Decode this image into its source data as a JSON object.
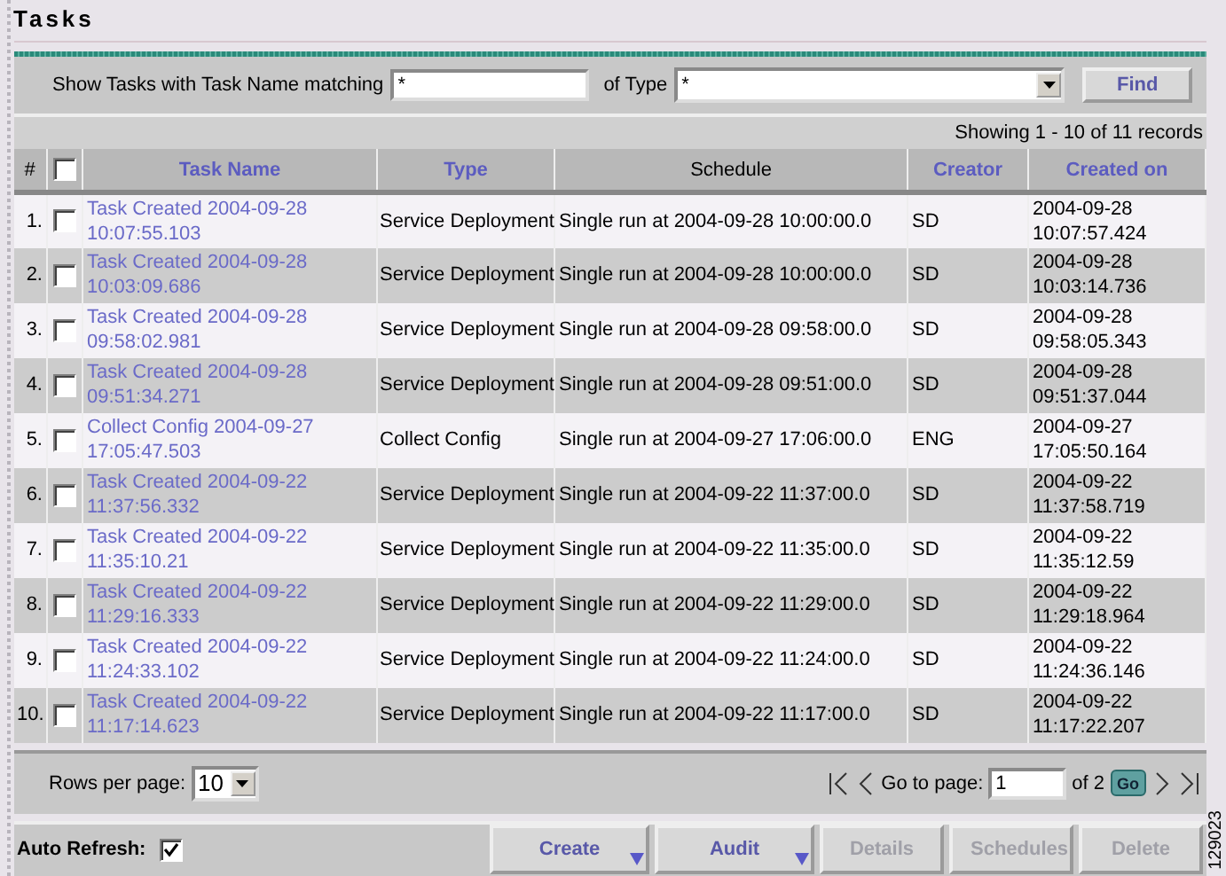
{
  "title": "Tasks",
  "filter": {
    "name_label": "Show Tasks with Task Name matching",
    "name_value": "*",
    "type_label": "of Type",
    "type_value": "*",
    "find_button": "Find"
  },
  "record_count": "Showing 1 - 10 of 11 records",
  "table": {
    "select_all_checked": false,
    "columns": [
      {
        "label": "#",
        "sortable": false
      },
      {
        "label": "Task Name",
        "sortable": true
      },
      {
        "label": "Type",
        "sortable": true
      },
      {
        "label": "Schedule",
        "sortable": false
      },
      {
        "label": "Creator",
        "sortable": true
      },
      {
        "label": "Created on",
        "sortable": true
      }
    ],
    "rows": [
      {
        "index": "1.",
        "checked": false,
        "task_name": "Task Created 2004-09-28 10:07:55.103",
        "type": "Service Deployment",
        "schedule": "Single run at 2004-09-28 10:00:00.0",
        "creator": "SD",
        "created_on": "2004-09-28 10:07:57.424"
      },
      {
        "index": "2.",
        "checked": false,
        "task_name": "Task Created 2004-09-28 10:03:09.686",
        "type": "Service Deployment",
        "schedule": "Single run at 2004-09-28 10:00:00.0",
        "creator": "SD",
        "created_on": "2004-09-28 10:03:14.736"
      },
      {
        "index": "3.",
        "checked": false,
        "task_name": "Task Created 2004-09-28 09:58:02.981",
        "type": "Service Deployment",
        "schedule": "Single run at 2004-09-28 09:58:00.0",
        "creator": "SD",
        "created_on": "2004-09-28 09:58:05.343"
      },
      {
        "index": "4.",
        "checked": false,
        "task_name": "Task Created 2004-09-28 09:51:34.271",
        "type": "Service Deployment",
        "schedule": "Single run at 2004-09-28 09:51:00.0",
        "creator": "SD",
        "created_on": "2004-09-28 09:51:37.044"
      },
      {
        "index": "5.",
        "checked": false,
        "task_name": "Collect Config 2004-09-27 17:05:47.503",
        "type": "Collect Config",
        "schedule": "Single run at 2004-09-27 17:06:00.0",
        "creator": "ENG",
        "created_on": "2004-09-27 17:05:50.164"
      },
      {
        "index": "6.",
        "checked": false,
        "task_name": "Task Created 2004-09-22 11:37:56.332",
        "type": "Service Deployment",
        "schedule": "Single run at 2004-09-22 11:37:00.0",
        "creator": "SD",
        "created_on": "2004-09-22 11:37:58.719"
      },
      {
        "index": "7.",
        "checked": false,
        "task_name": "Task Created 2004-09-22 11:35:10.21",
        "type": "Service Deployment",
        "schedule": "Single run at 2004-09-22 11:35:00.0",
        "creator": "SD",
        "created_on": "2004-09-22 11:35:12.59"
      },
      {
        "index": "8.",
        "checked": false,
        "task_name": "Task Created 2004-09-22 11:29:16.333",
        "type": "Service Deployment",
        "schedule": "Single run at 2004-09-22 11:29:00.0",
        "creator": "SD",
        "created_on": "2004-09-22 11:29:18.964"
      },
      {
        "index": "9.",
        "checked": false,
        "task_name": "Task Created 2004-09-22 11:24:33.102",
        "type": "Service Deployment",
        "schedule": "Single run at 2004-09-22 11:24:00.0",
        "creator": "SD",
        "created_on": "2004-09-22 11:24:36.146"
      },
      {
        "index": "10.",
        "checked": false,
        "task_name": "Task Created 2004-09-22 11:17:14.623",
        "type": "Service Deployment",
        "schedule": "Single run at 2004-09-22 11:17:00.0",
        "creator": "SD",
        "created_on": "2004-09-22 11:17:22.207"
      }
    ]
  },
  "pagination": {
    "rows_label": "Rows per page:",
    "rows_value": "10",
    "goto_label": "Go to page:",
    "page_value": "1",
    "page_total": "of 2",
    "go_button": "Go"
  },
  "auto_refresh": {
    "label": "Auto Refresh:",
    "checked": true
  },
  "buttons": [
    {
      "label": "Create",
      "disabled": false,
      "dropdown": true
    },
    {
      "label": "Audit",
      "disabled": false,
      "dropdown": true
    },
    {
      "label": "Details",
      "disabled": true,
      "dropdown": false
    },
    {
      "label": "Schedules",
      "disabled": true,
      "dropdown": false
    },
    {
      "label": "Delete",
      "disabled": true,
      "dropdown": false
    }
  ],
  "figure_number": "129023"
}
